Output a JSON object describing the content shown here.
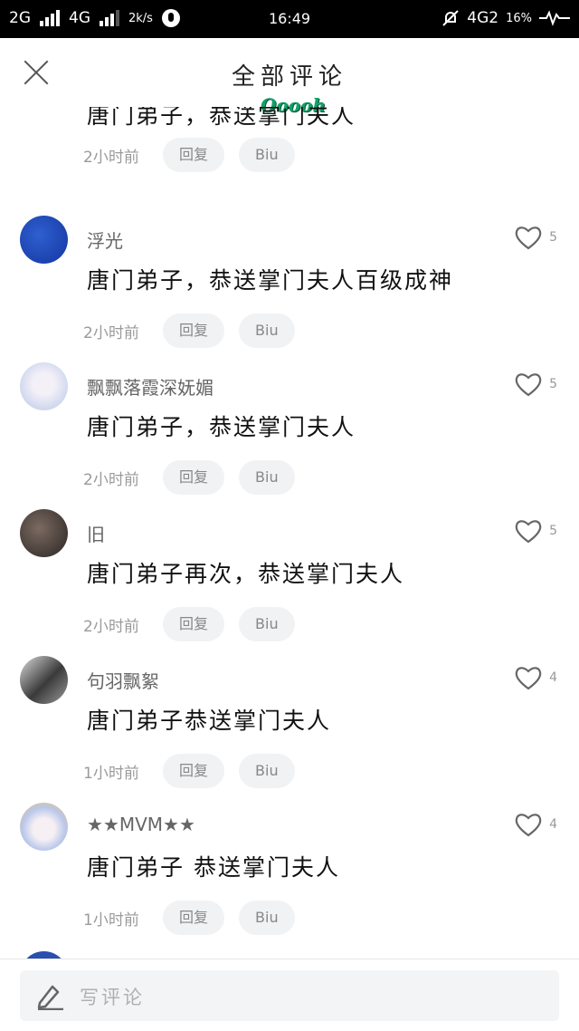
{
  "status_bar": {
    "net1": "2G",
    "net2": "4G",
    "speed": "2k/s",
    "time": "16:49",
    "net3": "4G2",
    "battery": "16%"
  },
  "header": {
    "title": "全部评论",
    "sticker_text": "Ooooh"
  },
  "comments": [
    {
      "username": "",
      "text": "唐门弟子，恭送掌门夫人",
      "time": "2小时前",
      "reply_label": "回复",
      "biu_label": "Biu",
      "likes": ""
    },
    {
      "username": "浮光",
      "text": "唐门弟子，恭送掌门夫人百级成神",
      "time": "2小时前",
      "reply_label": "回复",
      "biu_label": "Biu",
      "likes": "5"
    },
    {
      "username": "飘飘落霞深妩媚",
      "text": "唐门弟子，恭送掌门夫人",
      "time": "2小时前",
      "reply_label": "回复",
      "biu_label": "Biu",
      "likes": "5"
    },
    {
      "username": "旧",
      "text": "唐门弟子再次，恭送掌门夫人",
      "time": "2小时前",
      "reply_label": "回复",
      "biu_label": "Biu",
      "likes": "5"
    },
    {
      "username": "句羽飘絮",
      "text": "唐门弟子恭送掌门夫人",
      "time": "1小时前",
      "reply_label": "回复",
      "biu_label": "Biu",
      "likes": "4"
    },
    {
      "username": "★★MVM★★",
      "text": "唐门弟子 恭送掌门夫人",
      "time": "1小时前",
      "reply_label": "回复",
      "biu_label": "Biu",
      "likes": "4"
    }
  ],
  "composer": {
    "placeholder": "写评论"
  },
  "colors": {
    "sticker": "#14a06a",
    "pill_bg": "#f1f2f4",
    "avatar_blue": "#1d47b8"
  }
}
